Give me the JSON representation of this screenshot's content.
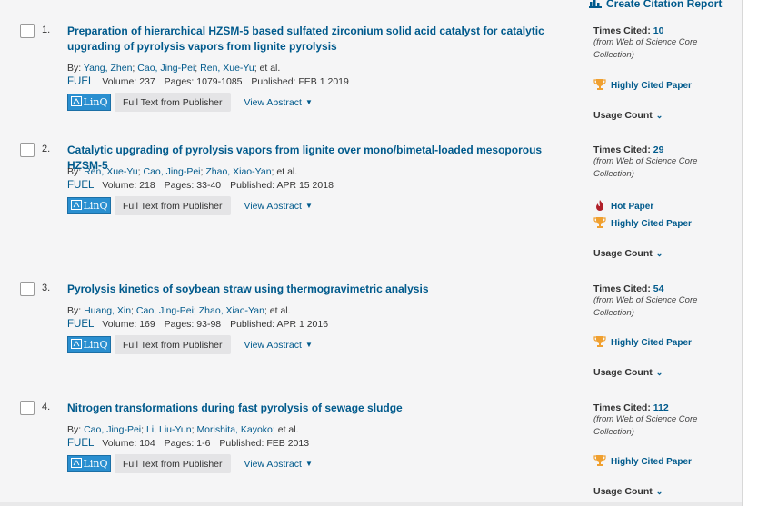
{
  "header": {
    "citation_report": "Create Citation Report",
    "icon": "bar-chart-icon"
  },
  "common": {
    "by": "By:",
    "volume_label": "Volume:",
    "pages_label": "Pages:",
    "published_label": "Published:",
    "linq": "LinQ",
    "full_text": "Full Text from Publisher",
    "view_abstract": "View Abstract",
    "times_cited_label": "Times Cited:",
    "wos_note": "(from Web of Science Core Collection)",
    "highly_cited": "Highly Cited Paper",
    "hot_paper": "Hot Paper",
    "usage_count": "Usage Count",
    "colors": {
      "link": "#005a8c",
      "trophy": "#f0a030",
      "flame": "#b0202a",
      "linq": "#2a8fd0"
    }
  },
  "records": [
    {
      "num": "1.",
      "title": "Preparation of hierarchical HZSM-5 based sulfated zirconium solid acid catalyst for catalytic upgrading of pyrolysis vapors from lignite pyrolysis",
      "authors": [
        "Yang, Zhen",
        "Cao, Jing-Pei",
        "Ren, Xue-Yu"
      ],
      "etal": "et al.",
      "journal": "FUEL",
      "volume": "237",
      "pages": "1079-1085",
      "published": "FEB 1 2019",
      "times_cited": "10"
    },
    {
      "num": "2.",
      "title": "Catalytic upgrading of pyrolysis vapors from lignite over mono/bimetal-loaded mesoporous HZSM-5",
      "authors": [
        "Ren, Xue-Yu",
        "Cao, Jing-Pei",
        "Zhao, Xiao-Yan"
      ],
      "etal": "et al.",
      "journal": "FUEL",
      "volume": "218",
      "pages": "33-40",
      "published": "APR 15 2018",
      "times_cited": "29"
    },
    {
      "num": "3.",
      "title": "Pyrolysis kinetics of soybean straw using thermogravimetric analysis",
      "authors": [
        "Huang, Xin",
        "Cao, Jing-Pei",
        "Zhao, Xiao-Yan"
      ],
      "etal": "et al.",
      "journal": "FUEL",
      "volume": "169",
      "pages": "93-98",
      "published": "APR 1 2016",
      "times_cited": "54"
    },
    {
      "num": "4.",
      "title": "Nitrogen transformations during fast pyrolysis of sewage sludge",
      "authors": [
        "Cao, Jing-Pei",
        "Li, Liu-Yun",
        "Morishita, Kayoko"
      ],
      "etal": "et al.",
      "journal": "FUEL",
      "volume": "104",
      "pages": "1-6",
      "published": "FEB 2013",
      "times_cited": "112"
    }
  ]
}
